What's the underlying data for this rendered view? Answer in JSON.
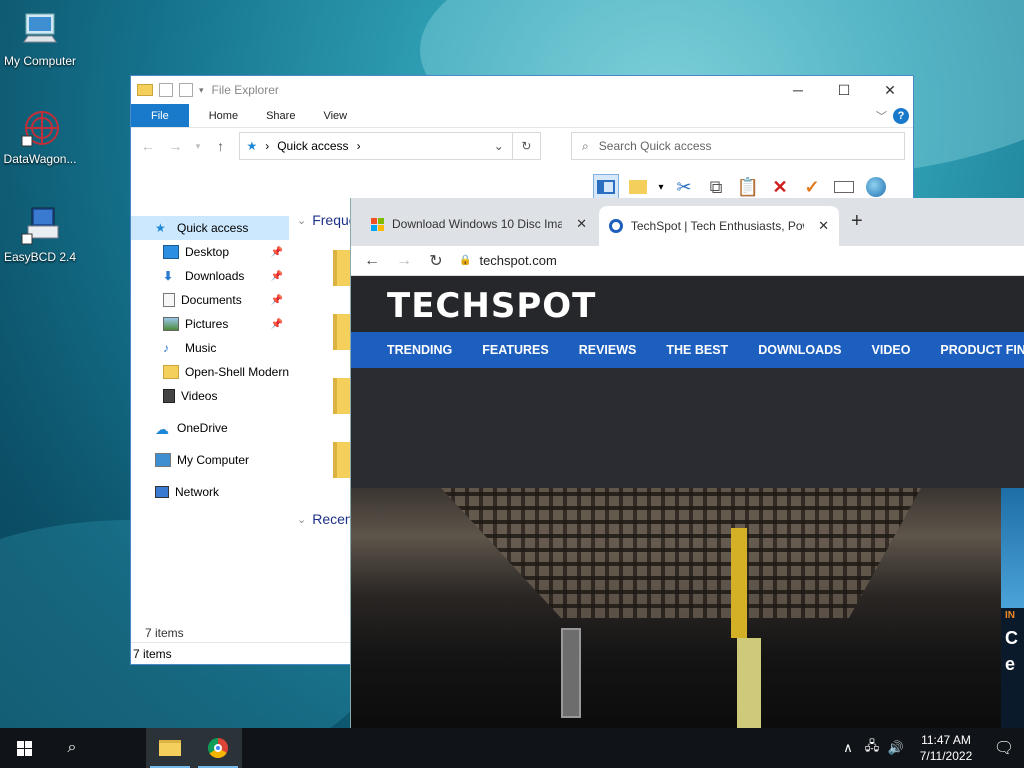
{
  "desktop": {
    "icons": [
      {
        "label": "My Computer",
        "icon": "computer-icon"
      },
      {
        "label": "DataWagon...",
        "icon": "datawagon-icon"
      },
      {
        "label": "EasyBCD 2.4",
        "icon": "easybcd-icon"
      }
    ]
  },
  "explorer": {
    "title": "File Explorer",
    "tabs": [
      "File",
      "Home",
      "Share",
      "View"
    ],
    "address": "Quick access",
    "search_placeholder": "Search Quick access",
    "nav": [
      {
        "label": "Quick access",
        "icon": "star-icon"
      },
      {
        "label": "Desktop",
        "icon": "desktop-icon",
        "pinned": true
      },
      {
        "label": "Downloads",
        "icon": "download-icon",
        "pinned": true
      },
      {
        "label": "Documents",
        "icon": "documents-icon",
        "pinned": true
      },
      {
        "label": "Pictures",
        "icon": "pictures-icon",
        "pinned": true
      },
      {
        "label": "Music",
        "icon": "music-icon"
      },
      {
        "label": "Open-Shell Modern",
        "icon": "folder-icon"
      },
      {
        "label": "Videos",
        "icon": "videos-icon"
      },
      {
        "label": "OneDrive",
        "icon": "cloud-icon"
      },
      {
        "label": "My Computer",
        "icon": "computer-icon"
      },
      {
        "label": "Network",
        "icon": "network-icon"
      }
    ],
    "sections": {
      "frequent": "Freque",
      "recent": "Recen"
    },
    "status_items": "7 items",
    "statusbar_items": "7 items"
  },
  "chrome": {
    "tabs": [
      {
        "title": "Download Windows 10 Disc Imag",
        "icon": "microsoft-icon"
      },
      {
        "title": "TechSpot | Tech Enthusiasts, Pow",
        "icon": "techspot-icon"
      }
    ],
    "url": "techspot.com",
    "site": {
      "logo": "TECHSPOT",
      "nav": [
        "TRENDING",
        "FEATURES",
        "REVIEWS",
        "THE BEST",
        "DOWNLOADS",
        "VIDEO",
        "PRODUCT FIND"
      ],
      "side_text": [
        "IN",
        "C",
        "e"
      ]
    }
  },
  "taskbar": {
    "time": "11:47 AM",
    "date": "7/11/2022"
  }
}
